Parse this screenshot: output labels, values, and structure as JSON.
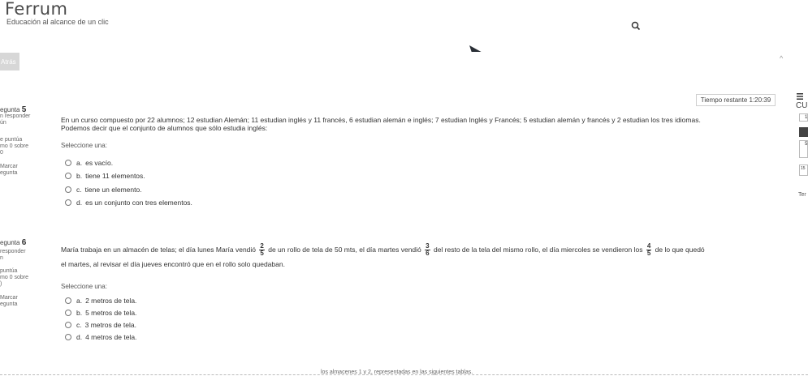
{
  "header": {
    "brand_name": "Ferrum",
    "brand_tagline": "Educación al alcance de un clic"
  },
  "nav": {
    "back_label": "Atrás"
  },
  "timer": {
    "label": "Tiempo restante 1:20:39"
  },
  "side_panel": {
    "title": "CU",
    "items": [
      "1",
      "5",
      "15"
    ],
    "footer": "Ter"
  },
  "questions": [
    {
      "number_label": "egunta",
      "number": "5",
      "status": "n responder",
      "status2": "ún",
      "points": "e puntúa",
      "points2": "mo 0 sobre",
      "points3": "0",
      "flag": "Marcar",
      "flag2": "egunta",
      "text_line1": "En un curso compuesto por 22 alumnos; 12 estudian Alemán; 11 estudian inglés y 11 francés, 6 estudian alemán e inglés; 7 estudian Inglés y Francés; 5 estudian alemán y francés y 2 estudian los tres idiomas.",
      "text_line2": "Podemos decir que el conjunto de alumnos que sólo estudia inglés:",
      "select_label": "Seleccione una:",
      "options": [
        {
          "letter": "a.",
          "text": "es vacío."
        },
        {
          "letter": "b.",
          "text": "tiene 11 elementos."
        },
        {
          "letter": "c.",
          "text": "tiene un elemento."
        },
        {
          "letter": "d.",
          "text": "es un conjunto con tres elementos."
        }
      ]
    },
    {
      "number_label": "egunta",
      "number": "6",
      "status": "responder",
      "status2": "n",
      "points": "puntúa",
      "points2": "mo 0 sobre",
      "points3": ")",
      "flag": "Marcar",
      "flag2": "egunta",
      "text_part1": "María trabaja en un almacén de telas; el día lunes María vendió",
      "frac1_num": "2",
      "frac1_den": "5",
      "text_part2": "de un rollo de tela de 50 mts, el día martes vendió",
      "frac2_num": "3",
      "frac2_den": "6",
      "text_part3": "del resto de la tela del mismo rollo, el día miercoles se vendieron los",
      "frac3_num": "4",
      "frac3_den": "5",
      "text_part4": "de lo que quedó",
      "text_line2": "el martes, al revisar el día jueves encontró que en el rollo solo quedaban.",
      "select_label": "Seleccione una:",
      "options": [
        {
          "letter": "a.",
          "text": "2 metros de tela."
        },
        {
          "letter": "b.",
          "text": "5 metros de tela."
        },
        {
          "letter": "c.",
          "text": "3 metros de tela."
        },
        {
          "letter": "d.",
          "text": "4 metros de tela."
        }
      ]
    }
  ],
  "footer": {
    "text": "los almacenes 1 y 2, representadas en las siguientes tablas."
  }
}
